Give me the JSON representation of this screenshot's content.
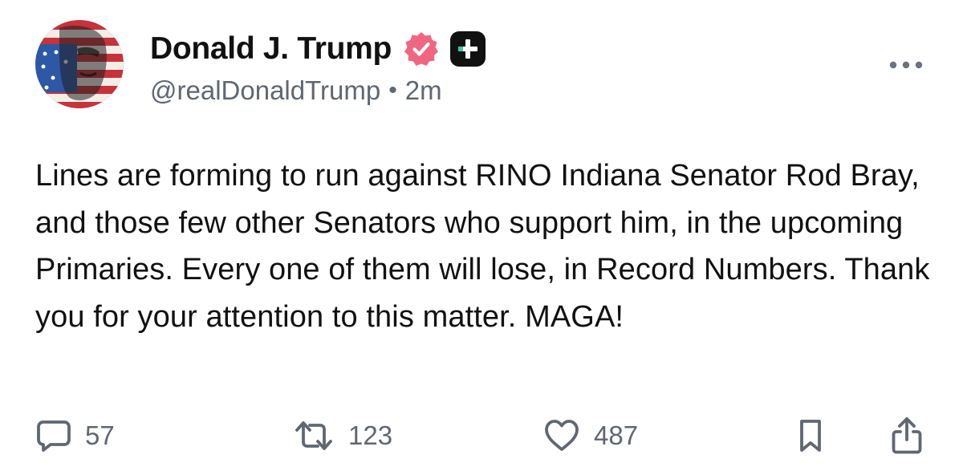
{
  "author": {
    "display_name": "Donald J. Trump",
    "handle": "@realDonaldTrump",
    "separator": "•",
    "timestamp": "2m",
    "verified_badge_color": "#f06681",
    "plus_badge_color": "#111111",
    "plus_badge_accent": "#3ec9a7"
  },
  "post": {
    "text": "Lines are forming to run against RINO Indiana Senator Rod Bray, and those few other Senators who support him, in the upcoming Primaries. Every one of them will lose, in Record Numbers. Thank you for your attention to this matter. MAGA!"
  },
  "actions": {
    "reply": {
      "icon": "reply-bubble-icon",
      "count": "57"
    },
    "retruth": {
      "icon": "retruth-arrows-icon",
      "count": "123"
    },
    "like": {
      "icon": "heart-icon",
      "count": "487"
    },
    "bookmark": {
      "icon": "bookmark-icon"
    },
    "share": {
      "icon": "share-icon"
    }
  },
  "menu": {
    "icon": "more-dots-icon"
  },
  "colors": {
    "text": "#111111",
    "muted": "#5f6772",
    "background": "#ffffff"
  }
}
